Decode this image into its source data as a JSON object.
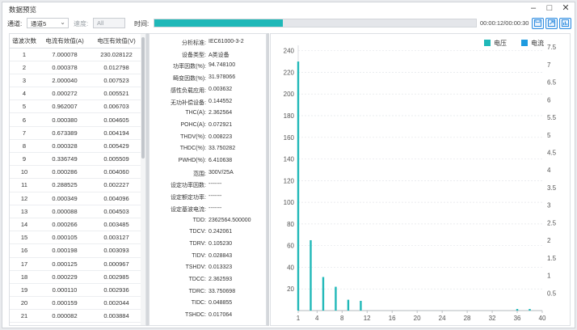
{
  "window": {
    "title": "数据预览",
    "controls": [
      "–",
      "□",
      "✕"
    ]
  },
  "toolbar": {
    "channel_label": "通道:",
    "channel_value": "通道5",
    "rate_label": "速度:",
    "rate_value": "All",
    "time_label": "时间:",
    "progress": 0.4,
    "time_text": "00:00:12/00:00:30",
    "accent": "#1fb8b8"
  },
  "table": {
    "headers": [
      "谐波次数",
      "电流有效值(A)",
      "电压有效值(V)"
    ],
    "rows": [
      [
        "1",
        "7.000078",
        "230.028122"
      ],
      [
        "2",
        "0.000378",
        "0.012798"
      ],
      [
        "3",
        "2.000040",
        "0.007523"
      ],
      [
        "4",
        "0.000272",
        "0.005521"
      ],
      [
        "5",
        "0.962007",
        "0.006703"
      ],
      [
        "6",
        "0.000380",
        "0.004605"
      ],
      [
        "7",
        "0.673389",
        "0.004194"
      ],
      [
        "8",
        "0.000328",
        "0.005429"
      ],
      [
        "9",
        "0.336749",
        "0.005509"
      ],
      [
        "10",
        "0.000286",
        "0.004060"
      ],
      [
        "11",
        "0.288525",
        "0.002227"
      ],
      [
        "12",
        "0.000349",
        "0.004096"
      ],
      [
        "13",
        "0.000088",
        "0.004503"
      ],
      [
        "14",
        "0.000266",
        "0.003485"
      ],
      [
        "15",
        "0.000105",
        "0.003127"
      ],
      [
        "16",
        "0.000198",
        "0.003093"
      ],
      [
        "17",
        "0.000125",
        "0.000967"
      ],
      [
        "18",
        "0.000229",
        "0.002985"
      ],
      [
        "19",
        "0.000110",
        "0.002936"
      ],
      [
        "20",
        "0.000159",
        "0.002044"
      ],
      [
        "21",
        "0.000082",
        "0.003884"
      ]
    ]
  },
  "info": [
    {
      "label": "分析标准:",
      "value": "IEC61000-3-2"
    },
    {
      "label": "设备类型:",
      "value": "A类设备"
    },
    {
      "label": "功率因数(%):",
      "value": "94.748100"
    },
    {
      "label": "畸变因数(%):",
      "value": "31.978066"
    },
    {
      "label": "感性负载应用:",
      "value": "0.003632"
    },
    {
      "label": "无功补偿设备:",
      "value": "0.144552"
    },
    {
      "label": "THC(A):",
      "value": "2.362564"
    },
    {
      "label": "POHC(A):",
      "value": "0.072921"
    },
    {
      "label": "THDV(%):",
      "value": "0.008223"
    },
    {
      "label": "THDC(%):",
      "value": "33.750282"
    },
    {
      "label": "PWHD(%):",
      "value": "6.410638"
    },
    {
      "label": "范围:",
      "value": "300V/25A"
    },
    {
      "label": "设定功率因数:",
      "value": "-------"
    },
    {
      "label": "设定额定功率:",
      "value": "-------"
    },
    {
      "label": "设定基波电流:",
      "value": "-------"
    },
    {
      "label": "TDD:",
      "value": "2362564.500000"
    },
    {
      "label": "TDCV:",
      "value": "0.242061"
    },
    {
      "label": "TDRV:",
      "value": "0.105230"
    },
    {
      "label": "TIDV:",
      "value": "0.028843"
    },
    {
      "label": "TSHDV:",
      "value": "0.013323"
    },
    {
      "label": "TDCC:",
      "value": "2.362593"
    },
    {
      "label": "TDRC:",
      "value": "33.750698"
    },
    {
      "label": "TIDC:",
      "value": "0.048855"
    },
    {
      "label": "TSHDC:",
      "value": "0.017064"
    }
  ],
  "chart_data": {
    "type": "bar",
    "title": "",
    "legend": [
      {
        "name": "电压",
        "color": "#1fb8b8"
      },
      {
        "name": "电流",
        "color": "#1e9be0"
      }
    ],
    "legend_position": "top-right",
    "x_ticks": [
      1,
      4,
      8,
      12,
      16,
      20,
      24,
      28,
      32,
      36,
      40
    ],
    "xlim": [
      1,
      40
    ],
    "y_left_ticks": [
      20,
      40,
      60,
      80,
      100,
      120,
      140,
      160,
      180,
      200,
      220,
      240
    ],
    "ylim_left": [
      0,
      245
    ],
    "y_right_ticks": [
      "0.5",
      "1",
      "1.5",
      "2",
      "2.5",
      "3",
      "3.5",
      "4",
      "4.5",
      "5",
      "5.5",
      "6",
      "6.5",
      "7",
      "7.5"
    ],
    "ylim_right": [
      0,
      7.55
    ],
    "grid": true,
    "x": [
      1,
      3,
      5,
      7,
      9,
      11,
      36,
      38
    ],
    "series": [
      {
        "name": "电压",
        "axis": "left",
        "values": [
          230,
          65,
          31,
          22,
          10,
          9,
          1.5,
          1.5
        ]
      }
    ]
  }
}
